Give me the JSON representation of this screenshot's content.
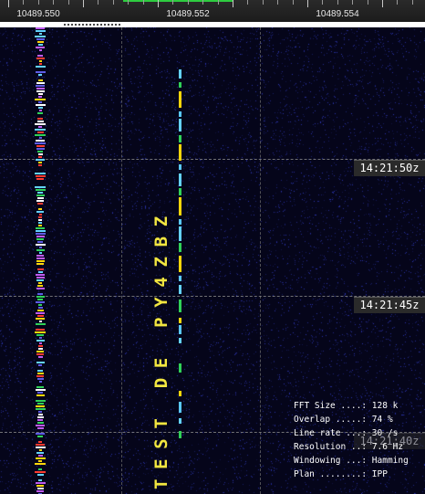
{
  "frequency_scale": {
    "labels": [
      "10489.550",
      "10489.552",
      "10489.554"
    ]
  },
  "timestamps": [
    "14:21:50z",
    "14:21:45z",
    "14:21:40z"
  ],
  "decoded_message": "TEST DE PY4ZBZ",
  "info": {
    "fft_size": "FFT Size ....: 128 k",
    "overlap": "Overlap .....: 74 %",
    "line_rate": "Line rate ...: 30 /s",
    "resolution": "Resolution ..: 7.6 Hz",
    "windowing": "Windowing ...: Hamming",
    "plan": "Plan ........: IPP"
  },
  "colors": {
    "background": "#05051a",
    "message": "#f2e640",
    "tuning_marker": "#2ecc40",
    "trace_colors": [
      "#ff3b30",
      "#ffd60a",
      "#30d158",
      "#64d2ff",
      "#5e5ce6",
      "#bf5af2",
      "#ffffff"
    ]
  }
}
